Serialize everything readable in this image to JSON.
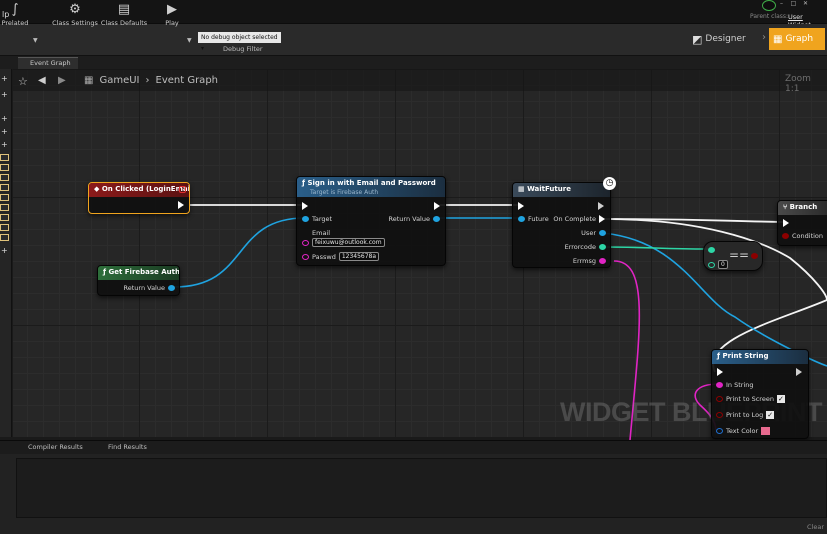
{
  "menu": {
    "help": "lp"
  },
  "window": {
    "parent_class_label": "Parent class:",
    "parent_class_value": "User Widget"
  },
  "toolbar": {
    "partial_label": "Prelated",
    "class_settings": "Class Settings",
    "class_defaults": "Class Defaults",
    "play": "Play",
    "debug_selected": "No debug object selected",
    "debug_filter": "Debug Filter",
    "designer": "Designer",
    "graph": "Graph"
  },
  "tabs": {
    "event_graph": "Event Graph"
  },
  "graph_header": {
    "root": "GameUI",
    "current": "Event Graph",
    "zoom": "Zoom 1:1"
  },
  "nodes": {
    "on_clicked": {
      "title": "On Clicked (LoginEmail)"
    },
    "get_firebase_auth": {
      "title": "Get Firebase Auth",
      "return_value": "Return Value"
    },
    "sign_in": {
      "title": "Sign in with Email and Password",
      "subtitle": "Target is Firebase Auth",
      "target": "Target",
      "return_value": "Return Value",
      "email_label": "Email",
      "email_value": "feixuwu@outlook.com",
      "password_label": "Passwd",
      "password_value": "12345678a"
    },
    "wait_future": {
      "title": "WaitFuture",
      "future": "Future",
      "on_complete": "On Complete",
      "user": "User",
      "errorcode": "Errorcode",
      "errmsg": "Errmsg"
    },
    "equals": {
      "symbol": "==",
      "input_value": "0"
    },
    "branch": {
      "title": "Branch",
      "condition": "Condition"
    },
    "print_string": {
      "title": "Print String",
      "in_string": "In String",
      "print_to_screen": "Print to Screen",
      "print_to_log": "Print to Log",
      "text_color": "Text Color"
    }
  },
  "watermark": "WIDGET BLUEPRINT",
  "bottom": {
    "compiler_results": "Compiler Results",
    "find_results": "Find Results",
    "clear": "Clear"
  },
  "colors": {
    "accent_orange": "#f0a41e",
    "event_head": "#8b1a1a",
    "function_head": "#2a5f8a",
    "exec_wire": "#ffffff",
    "object_wire": "#1fa3e0",
    "int_wire": "#2dd6a6",
    "string_wire": "#e024c4",
    "bool_pin": "#8c0000"
  }
}
